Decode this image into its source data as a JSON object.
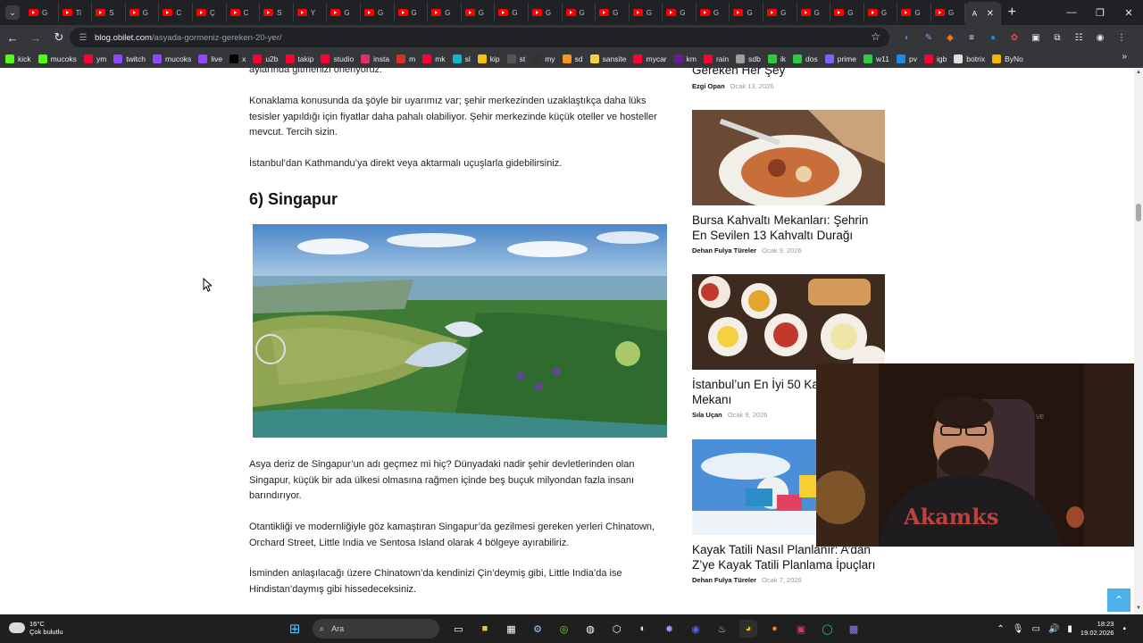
{
  "browser": {
    "tab_titles": [
      "G",
      "Ti",
      "S",
      "G",
      "C",
      "Ç",
      "C",
      "S",
      "Y",
      "G",
      "G",
      "G",
      "G",
      "G",
      "G",
      "G",
      "G",
      "G",
      "G",
      "G",
      "G",
      "G",
      "G",
      "G",
      "G",
      "G",
      "G",
      "G"
    ],
    "active_tab_title": "A",
    "url_domain": "blog.obilet.com",
    "url_path": "/asyada-gormeniz-gereken-20-yer/",
    "bookmarks": [
      {
        "label": "kick",
        "color": "#53fc18"
      },
      {
        "label": "mucoks",
        "color": "#53fc18"
      },
      {
        "label": "ym",
        "color": "#ff0033"
      },
      {
        "label": "twitch",
        "color": "#9146ff"
      },
      {
        "label": "mucoks",
        "color": "#9146ff"
      },
      {
        "label": "live",
        "color": "#9146ff"
      },
      {
        "label": "x",
        "color": "#000000"
      },
      {
        "label": "u2b",
        "color": "#ff0033"
      },
      {
        "label": "takip",
        "color": "#ff0033"
      },
      {
        "label": "studio",
        "color": "#ff0033"
      },
      {
        "label": "insta",
        "color": "#e1306c"
      },
      {
        "label": "m",
        "color": "#d93025"
      },
      {
        "label": "mk",
        "color": "#ff0033"
      },
      {
        "label": "sl",
        "color": "#13b5c9"
      },
      {
        "label": "kip",
        "color": "#f4c20d"
      },
      {
        "label": "st",
        "color": "#555555"
      },
      {
        "label": "my",
        "color": "#333333"
      },
      {
        "label": "sd",
        "color": "#f7931e"
      },
      {
        "label": "sansite",
        "color": "#f4d03f"
      },
      {
        "label": "mycar",
        "color": "#ff0033"
      },
      {
        "label": "km",
        "color": "#6a1b9a"
      },
      {
        "label": "rain",
        "color": "#ff0033"
      },
      {
        "label": "sdb",
        "color": "#9e9e9e"
      },
      {
        "label": "ik",
        "color": "#2ecc40"
      },
      {
        "label": "dos",
        "color": "#2ecc40"
      },
      {
        "label": "prime",
        "color": "#7b61ff"
      },
      {
        "label": "w11",
        "color": "#2ecc40"
      },
      {
        "label": "pv",
        "color": "#1e88e5"
      },
      {
        "label": "igb",
        "color": "#ff0033"
      },
      {
        "label": "botrix",
        "color": "#e0e0e0"
      },
      {
        "label": "ByNo",
        "color": "#f4b400"
      }
    ]
  },
  "article": {
    "p_top": "aylarında gitmenizi öneriyoruz.",
    "p1": "Konaklama konusunda da şöyle bir uyarımız var; şehir merkezinden uzaklaştıkça daha lüks tesisler yapıldığı için fiyatlar daha pahalı olabiliyor. Şehir merkezinde küçük oteller ve hosteller mevcut. Tercih sizin.",
    "p2": "İstanbul’dan Kathmandu’ya direkt veya aktarmalı uçuşlarla gidebilirsiniz.",
    "heading": "6) Singapur",
    "p3": "Asya deriz de Singapur’un adı geçmez mi hiç? Dünyadaki nadir şehir devletlerinden olan Singapur, küçük bir ada ülkesi olmasına rağmen içinde beş buçuk milyondan fazla insanı barındırıyor.",
    "p4": "Otantikliği ve modernliğiyle göz kamaştıran Singapur’da gezilmesi gereken yerleri Chinatown, Orchard Street, Little India ve Sentosa Island olarak 4 bölgeye ayırabiliriz.",
    "p5": "İsminden anlaşılacağı üzere Chinatown’da kendinizi Çin’deymiş gibi, Little India’da ise Hindistan’daymış gibi hissedeceksiniz."
  },
  "sidebar": {
    "post0_title_tail": "Gereken Her Şey",
    "post0_author": "Ezgi Opan",
    "post0_date": "Ocak 13, 2026",
    "posts": [
      {
        "title": "Bursa Kahvaltı Mekanları: Şehrin En Sevilen 13 Kahvaltı Durağı",
        "author": "Dehan Fulya Türeler",
        "date": "Ocak 9, 2026"
      },
      {
        "title": "İstanbul’un En İyi 50 Ka",
        "title_line2": "Mekanı",
        "author": "Sıla Uçan",
        "date": "Ocak 9, 2026"
      },
      {
        "title": "Kayak Tatili Nasıl Planlanır: A’dan Z’ye Kayak Tatili Planlama İpuçları",
        "author": "Dehan Fulya Türeler",
        "date": "Ocak 7, 2026"
      }
    ]
  },
  "taskbar": {
    "temp": "16°C",
    "weather": "Çok bulutlu",
    "search_placeholder": "Ara",
    "time": "18:23",
    "date": "19.02.2026"
  },
  "webcam": {
    "hoodie_text": "Akamks"
  }
}
